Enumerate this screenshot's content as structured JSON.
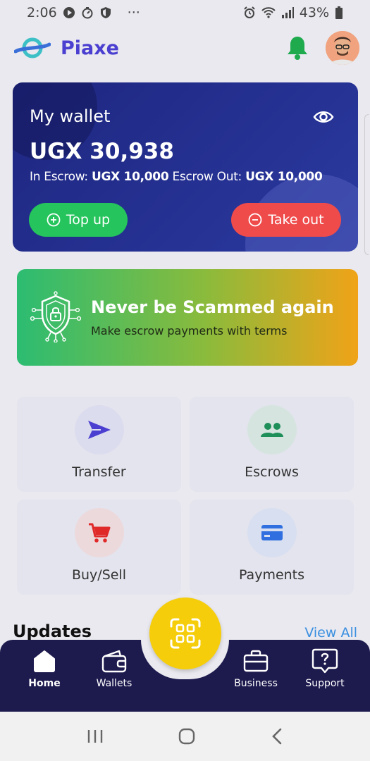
{
  "status_bar": {
    "time": "2:06",
    "dots": "···",
    "battery": "43%"
  },
  "header": {
    "app_name": "Piaxe"
  },
  "wallet": {
    "title": "My wallet",
    "balance": "UGX 30,938",
    "in_escrow_label": "In Escrow:",
    "in_escrow_value": "UGX 10,000",
    "escrow_out_label": "Escrow Out:",
    "escrow_out_value": "UGX 10,000",
    "topup_label": "Top up",
    "takeout_label": "Take out"
  },
  "banner": {
    "title": "Never be Scammed again",
    "subtitle": "Make escrow payments with terms"
  },
  "tiles": [
    {
      "label": "Transfer",
      "icon": "send-icon"
    },
    {
      "label": "Escrows",
      "icon": "people-icon"
    },
    {
      "label": "Buy/Sell",
      "icon": "cart-icon"
    },
    {
      "label": "Payments",
      "icon": "card-icon"
    }
  ],
  "updates": {
    "title": "Updates",
    "view_all": "View All"
  },
  "bottom_nav": [
    {
      "label": "Home",
      "icon": "home-icon",
      "active": true
    },
    {
      "label": "Wallets",
      "icon": "wallet-icon",
      "active": false
    },
    {
      "label": "Business",
      "icon": "briefcase-icon",
      "active": false
    },
    {
      "label": "Support",
      "icon": "support-icon",
      "active": false
    }
  ],
  "colors": {
    "brand": "#4a3fd0",
    "wallet_bg": "#1e2680",
    "topup": "#25c45c",
    "takeout": "#ef4b4b",
    "scan": "#f5cd0a",
    "nav_bg": "#1d1a4e"
  }
}
